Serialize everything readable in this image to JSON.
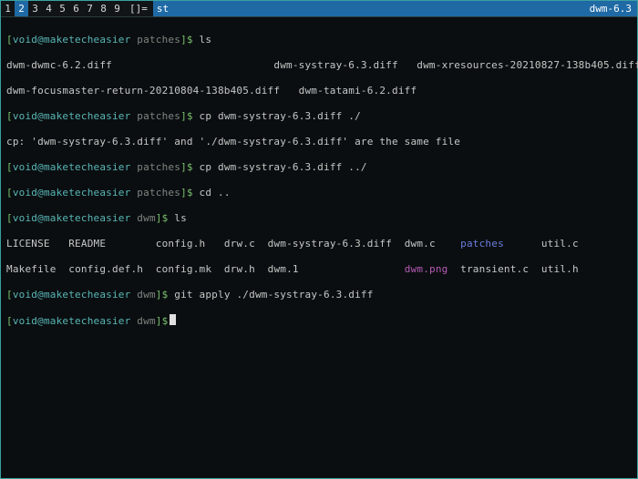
{
  "bar": {
    "tags": [
      "1",
      "2",
      "3",
      "4",
      "5",
      "6",
      "7",
      "8",
      "9"
    ],
    "active_tag_index": 1,
    "layout_symbol": "[]=",
    "title": "st",
    "status": "dwm-6.3"
  },
  "term": {
    "prompt_user_host": "void@maketecheasier",
    "prompt_dir_patches": "patches",
    "prompt_dir_dwm": "dwm",
    "lines": {
      "l01_cmd": "ls",
      "l02": "dwm-dwmc-6.2.diff                          dwm-systray-6.3.diff   dwm-xresources-20210827-138b405.diff",
      "l03": "dwm-focusmaster-return-20210804-138b405.diff   dwm-tatami-6.2.diff",
      "l04_cmd": "cp dwm-systray-6.3.diff ./",
      "l05": "cp: 'dwm-systray-6.3.diff' and './dwm-systray-6.3.diff' are the same file",
      "l06_cmd": "cp dwm-systray-6.3.diff ../",
      "l07_cmd": "cd ..",
      "l08_cmd": "ls",
      "ls2_row1": {
        "c1": "LICENSE",
        "c2": "README",
        "c3": "config.h",
        "c4": "drw.c",
        "c5": "dwm-systray-6.3.diff",
        "c6": "dwm.c",
        "c7": "patches",
        "c8": "util.c"
      },
      "ls2_row2": {
        "c1": "Makefile",
        "c2": "config.def.h",
        "c3": "config.mk",
        "c4": "drw.h",
        "c5": "dwm.1",
        "c6": "dwm.png",
        "c7": "transient.c",
        "c8": "util.h"
      },
      "l11_cmd": "git apply ./dwm-systray-6.3.diff"
    }
  }
}
